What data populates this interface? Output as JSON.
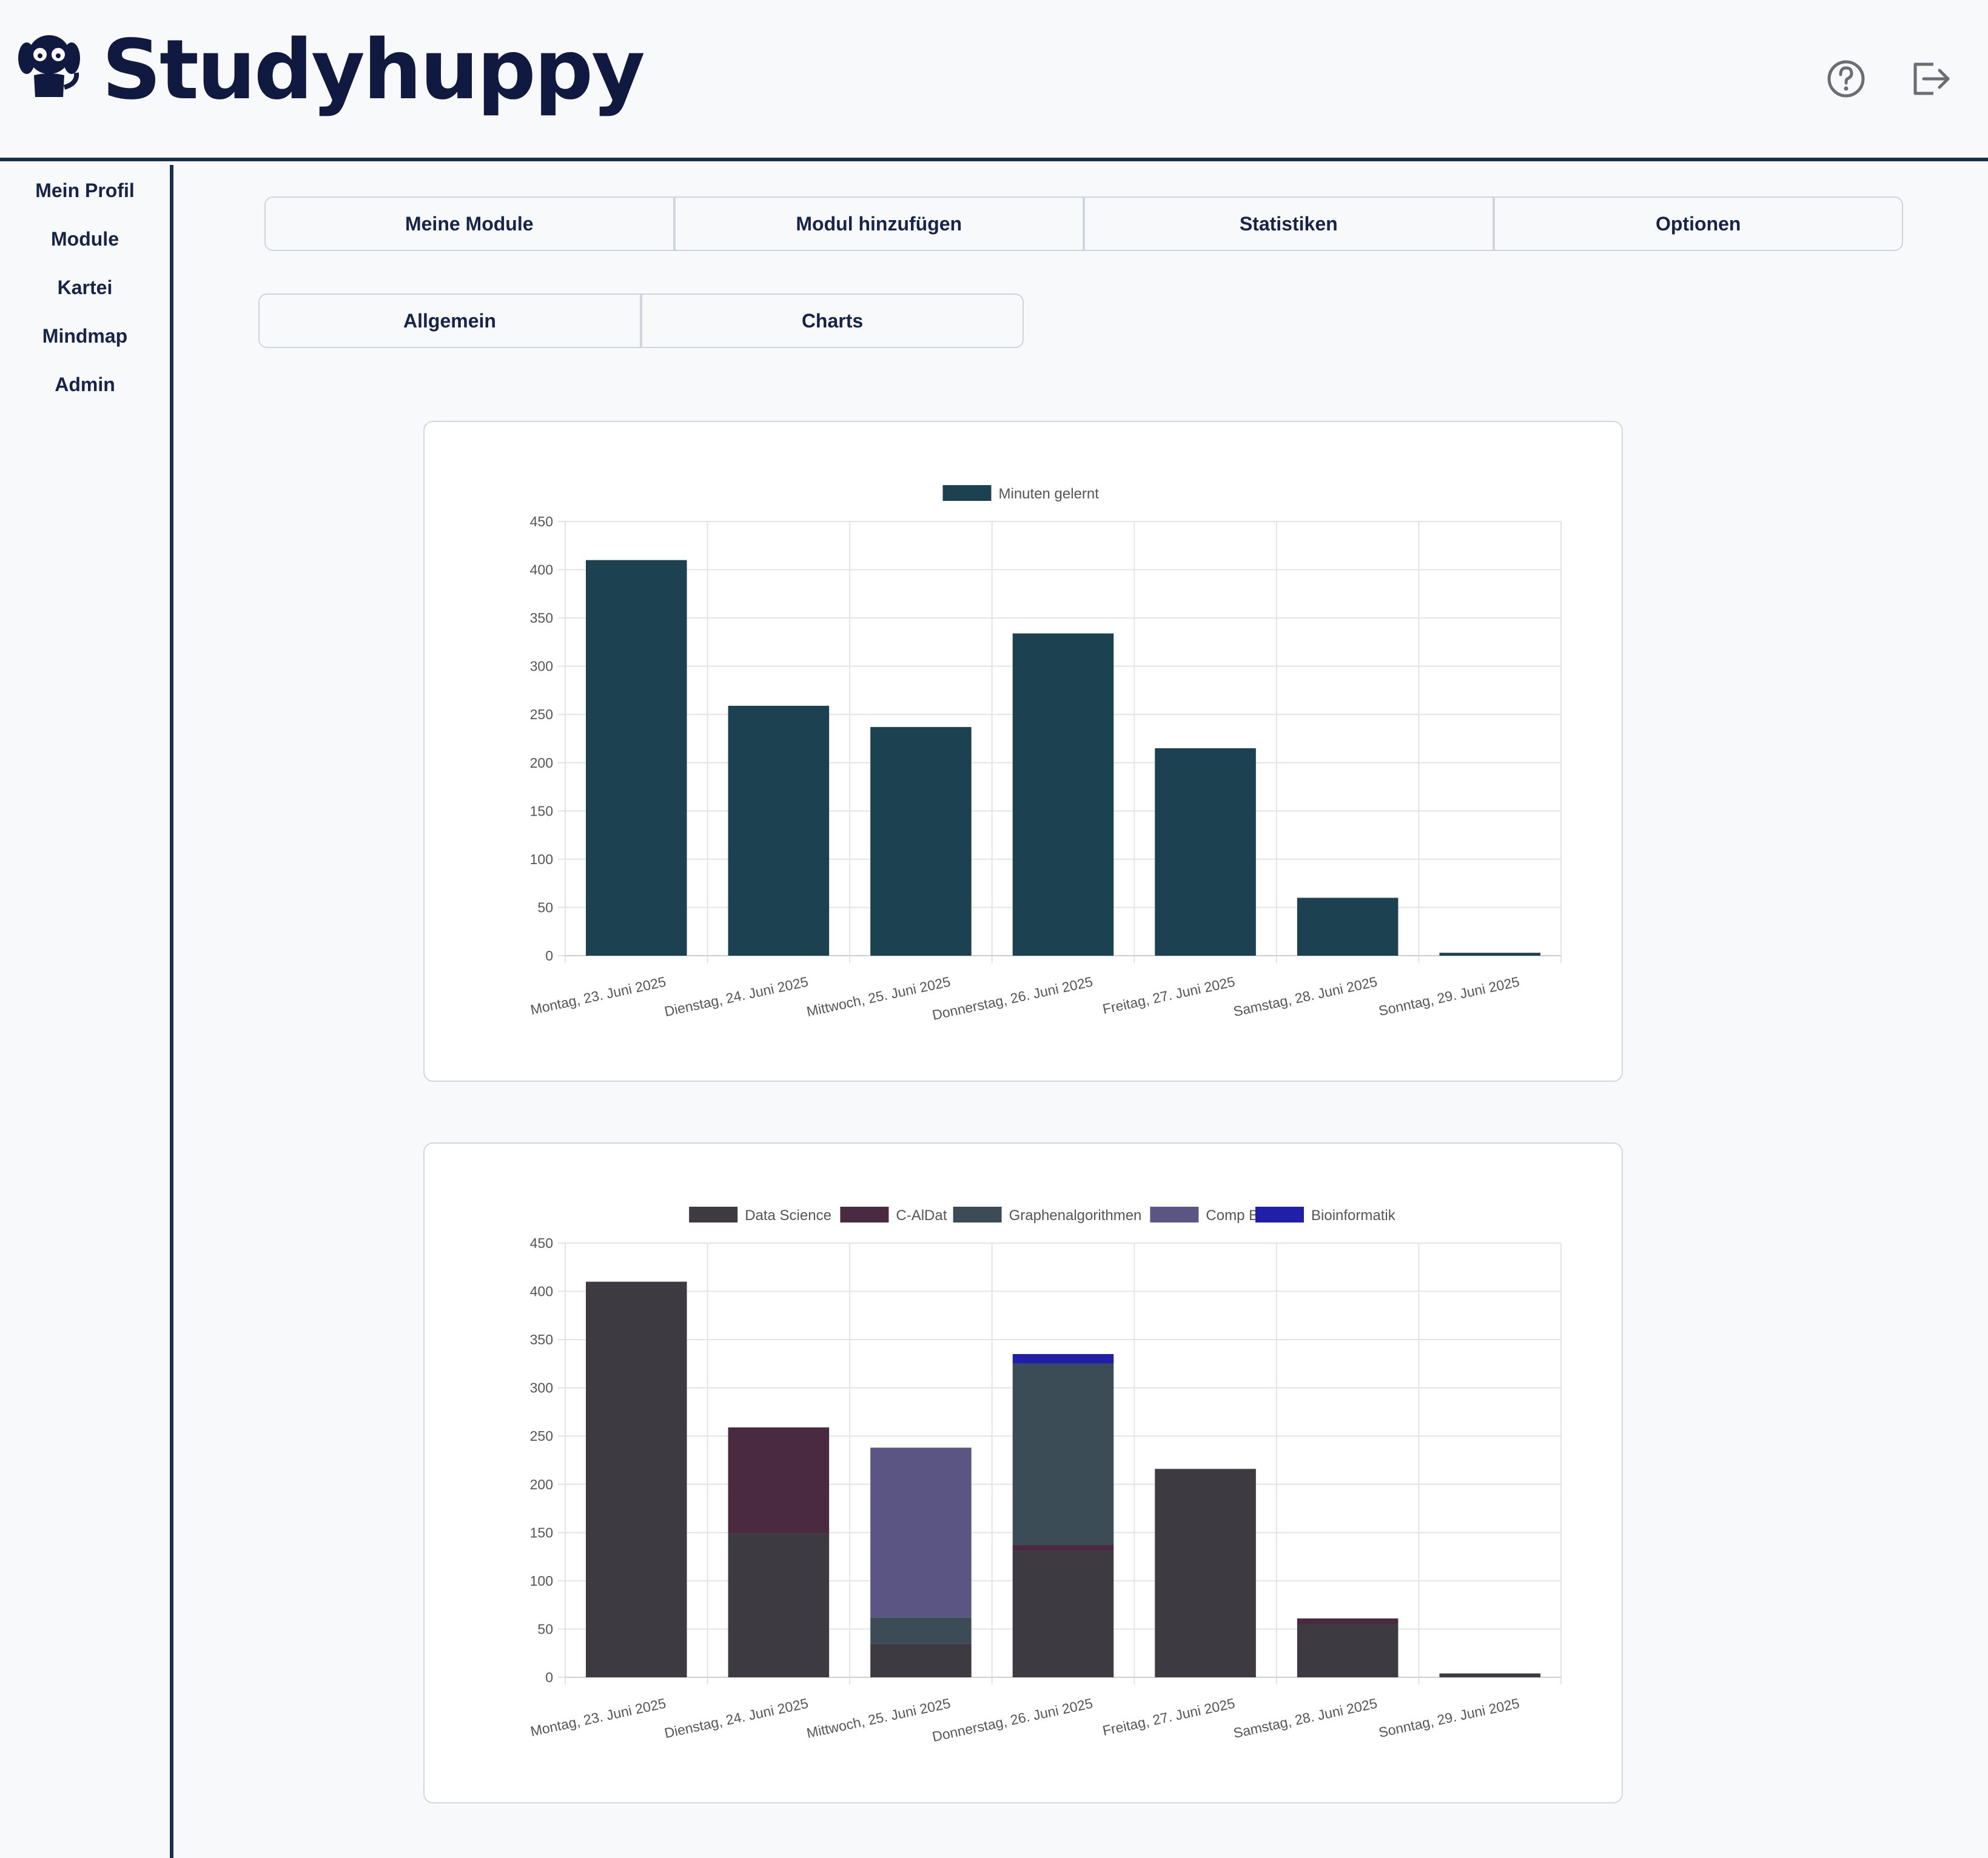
{
  "header": {
    "brand": "Studyhuppy",
    "icons": [
      "logo-dog-icon",
      "help-icon",
      "logout-icon"
    ]
  },
  "sidebar": {
    "items": [
      {
        "label": "Mein Profil"
      },
      {
        "label": "Module"
      },
      {
        "label": "Kartei"
      },
      {
        "label": "Mindmap"
      },
      {
        "label": "Admin"
      }
    ]
  },
  "main_tabs": [
    {
      "label": "Meine Module"
    },
    {
      "label": "Modul hinzufügen"
    },
    {
      "label": "Statistiken"
    },
    {
      "label": "Optionen"
    }
  ],
  "sub_tabs": [
    {
      "label": "Allgemein"
    },
    {
      "label": "Charts"
    }
  ],
  "colors": {
    "brand_text": "#101a40",
    "border_dark": "#1a2f4f",
    "bar_primary": "#1c4252"
  },
  "chart_data": [
    {
      "type": "bar",
      "categories": [
        "Montag, 23. Juni 2025",
        "Dienstag, 24. Juni 2025",
        "Mittwoch, 25. Juni 2025",
        "Donnerstag, 26. Juni 2025",
        "Freitag, 27. Juni 2025",
        "Samstag, 28. Juni 2025",
        "Sonntag, 29. Juni 2025"
      ],
      "series": [
        {
          "name": "Minuten gelernt",
          "color": "#1c4252",
          "values": [
            410,
            259,
            237,
            334,
            215,
            60,
            3
          ]
        }
      ],
      "ylim": [
        0,
        450
      ],
      "yticks": [
        0,
        50,
        100,
        150,
        200,
        250,
        300,
        350,
        400,
        450
      ],
      "legend": "top-center",
      "grid": true
    },
    {
      "type": "bar",
      "stacked": true,
      "categories": [
        "Montag, 23. Juni 2025",
        "Dienstag, 24. Juni 2025",
        "Mittwoch, 25. Juni 2025",
        "Donnerstag, 26. Juni 2025",
        "Freitag, 27. Juni 2025",
        "Samstag, 28. Juni 2025",
        "Sonntag, 29. Juni 2025"
      ],
      "series": [
        {
          "name": "Data Science",
          "color": "#3d3a42",
          "values": [
            410,
            149,
            35,
            131,
            216,
            55,
            4
          ]
        },
        {
          "name": "C-AlDat",
          "color": "#4a2a40",
          "values": [
            0,
            110,
            0,
            6,
            0,
            6,
            0
          ]
        },
        {
          "name": "Graphenalgorithmen",
          "color": "#3c4c56",
          "values": [
            0,
            0,
            27,
            188,
            0,
            0,
            0
          ]
        },
        {
          "name": "Comp B",
          "color": "#5a5583",
          "values": [
            0,
            0,
            176,
            0,
            0,
            0,
            0
          ]
        },
        {
          "name": "Bioinformatik",
          "color": "#1f1fa8",
          "values": [
            0,
            0,
            0,
            10,
            0,
            0,
            0
          ]
        }
      ],
      "ylim": [
        0,
        450
      ],
      "yticks": [
        0,
        50,
        100,
        150,
        200,
        250,
        300,
        350,
        400,
        450
      ],
      "legend": "top-center",
      "grid": true
    }
  ]
}
